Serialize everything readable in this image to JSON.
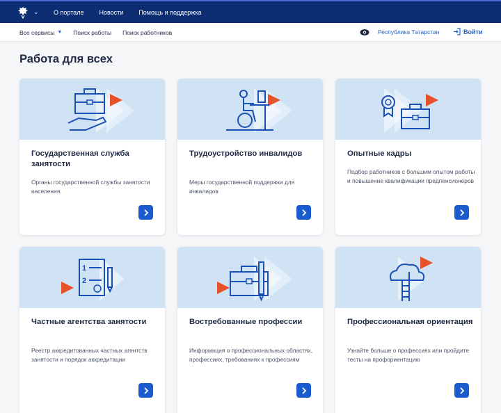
{
  "colors": {
    "header_bg": "#0d2d73",
    "accent": "#1a5ccf",
    "card_image_bg": "#cfe3f5",
    "play_orange": "#e8522a"
  },
  "topnav": {
    "items": [
      "О портале",
      "Новости",
      "Помощь и поддержка"
    ]
  },
  "subnav": {
    "all_services": "Все сервисы",
    "items": [
      "Поиск работы",
      "Поиск работников"
    ]
  },
  "header": {
    "region": "Республика Татарстан",
    "login": "Войти"
  },
  "page": {
    "title": "Работа для всех"
  },
  "cards": [
    {
      "title": "Государственная служба занятости",
      "desc": "Органы государственной службы занятости населения.",
      "icon": "briefcase-hand-icon"
    },
    {
      "title": "Трудоустройство инвалидов",
      "desc": "Меры государственной поддержки для инвалидов",
      "icon": "wheelchair-worker-icon"
    },
    {
      "title": "Опытные кадры",
      "desc": "Подбор работников с большим опытом работы и повышение квалификации предпенсионеров",
      "icon": "medal-briefcase-icon"
    },
    {
      "title": "Частные агентства занятости",
      "desc": "Реестр аккредитованных частных агентств занятости и порядок аккредитации",
      "icon": "document-list-icon"
    },
    {
      "title": "Востребованные профессии",
      "desc": "Информация о профессиональных областях, профессиях, требованиях к профессиям",
      "icon": "briefcase-pen-icon"
    },
    {
      "title": "Профессиональная ориентация",
      "desc": "Узнайте больше о профессиях или пройдите тесты на профориентацию",
      "icon": "cloud-ladder-icon"
    }
  ]
}
